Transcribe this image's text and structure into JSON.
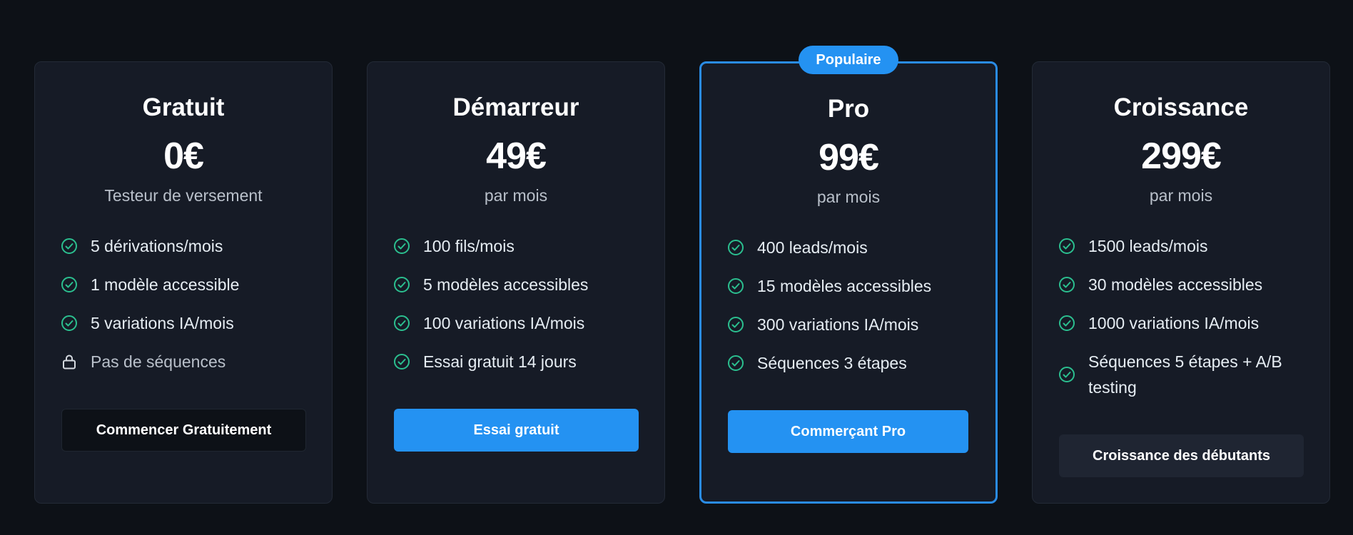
{
  "colors": {
    "background": "#0d1117",
    "card": "#161b26",
    "accent": "#2492f2",
    "check": "#2bbf8f",
    "featured_border": "#2a8ce6"
  },
  "plans": [
    {
      "name": "Gratuit",
      "price": "0€",
      "period": "Testeur de versement",
      "features": [
        {
          "icon": "check-circle-icon",
          "label": "5 dérivations/mois"
        },
        {
          "icon": "check-circle-icon",
          "label": "1 modèle accessible"
        },
        {
          "icon": "check-circle-icon",
          "label": "5 variations IA/mois"
        },
        {
          "icon": "lock-icon",
          "label": "Pas de séquences"
        }
      ],
      "button": "Commencer Gratuitement"
    },
    {
      "name": "Démarreur",
      "price": "49€",
      "period": "par mois",
      "features": [
        {
          "icon": "check-circle-icon",
          "label": "100 fils/mois"
        },
        {
          "icon": "check-circle-icon",
          "label": "5 modèles accessibles"
        },
        {
          "icon": "check-circle-icon",
          "label": "100 variations IA/mois"
        },
        {
          "icon": "check-circle-icon",
          "label": "Essai gratuit 14 jours"
        }
      ],
      "button": "Essai gratuit"
    },
    {
      "name": "Pro",
      "price": "99€",
      "period": "par mois",
      "badge": "Populaire",
      "features": [
        {
          "icon": "check-circle-icon",
          "label": "400 leads/mois"
        },
        {
          "icon": "check-circle-icon",
          "label": "15 modèles accessibles"
        },
        {
          "icon": "check-circle-icon",
          "label": "300 variations IA/mois"
        },
        {
          "icon": "check-circle-icon",
          "label": "Séquences 3 étapes"
        }
      ],
      "button": "Commerçant Pro"
    },
    {
      "name": "Croissance",
      "price": "299€",
      "period": "par mois",
      "features": [
        {
          "icon": "check-circle-icon",
          "label": "1500 leads/mois"
        },
        {
          "icon": "check-circle-icon",
          "label": "30 modèles accessibles"
        },
        {
          "icon": "check-circle-icon",
          "label": "1000 variations IA/mois"
        },
        {
          "icon": "check-circle-icon",
          "label": "Séquences 5 étapes + A/B testing"
        }
      ],
      "button": "Croissance des débutants"
    }
  ]
}
